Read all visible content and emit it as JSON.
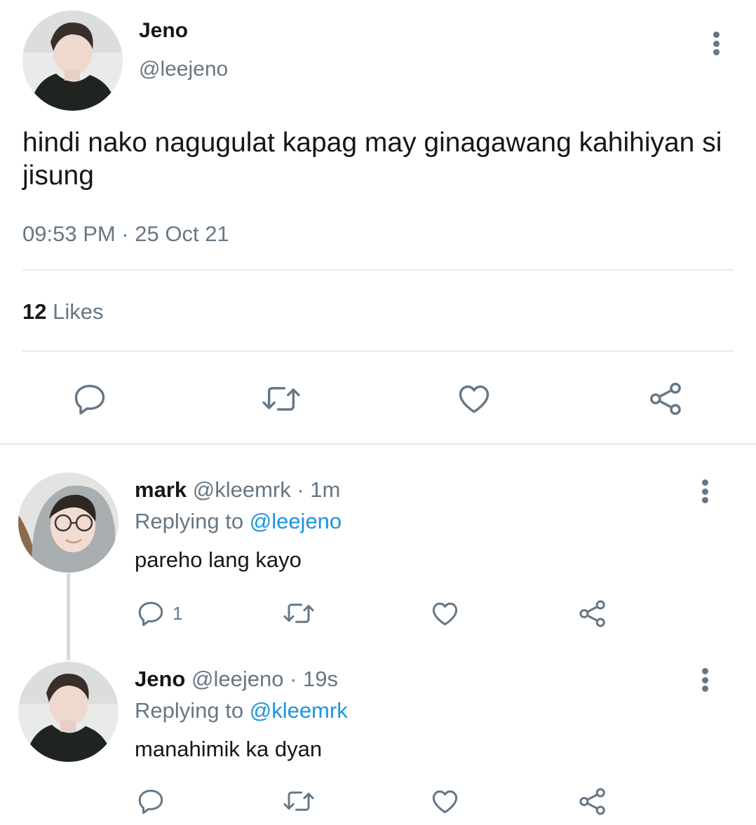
{
  "main_tweet": {
    "author_name": "Jeno",
    "author_handle": "@leejeno",
    "text": "hindi nako nagugulat kapag may ginagawang kahihiyan si jisung",
    "time": "09:53 PM",
    "separator": " · ",
    "date": "25 Oct 21",
    "likes_count": "12",
    "likes_label": "Likes"
  },
  "replies": [
    {
      "name": "mark",
      "handle": "@kleemrk",
      "dot": " · ",
      "time": "1m",
      "replying_prefix": "Replying to ",
      "replying_to": "@leejeno",
      "text": "pareho lang kayo",
      "reply_count": "1"
    },
    {
      "name": "Jeno",
      "handle": "@leejeno",
      "dot": " · ",
      "time": "19s",
      "replying_prefix": "Replying to ",
      "replying_to": "@kleemrk",
      "text": "manahimik ka dyan",
      "reply_count": ""
    }
  ],
  "colors": {
    "text_primary": "#14171a",
    "text_secondary": "#657786",
    "link": "#1b95e0",
    "divider": "#e6ecf0"
  },
  "icons": [
    "more-vertical-icon",
    "reply-icon",
    "retweet-icon",
    "like-icon",
    "share-icon"
  ]
}
